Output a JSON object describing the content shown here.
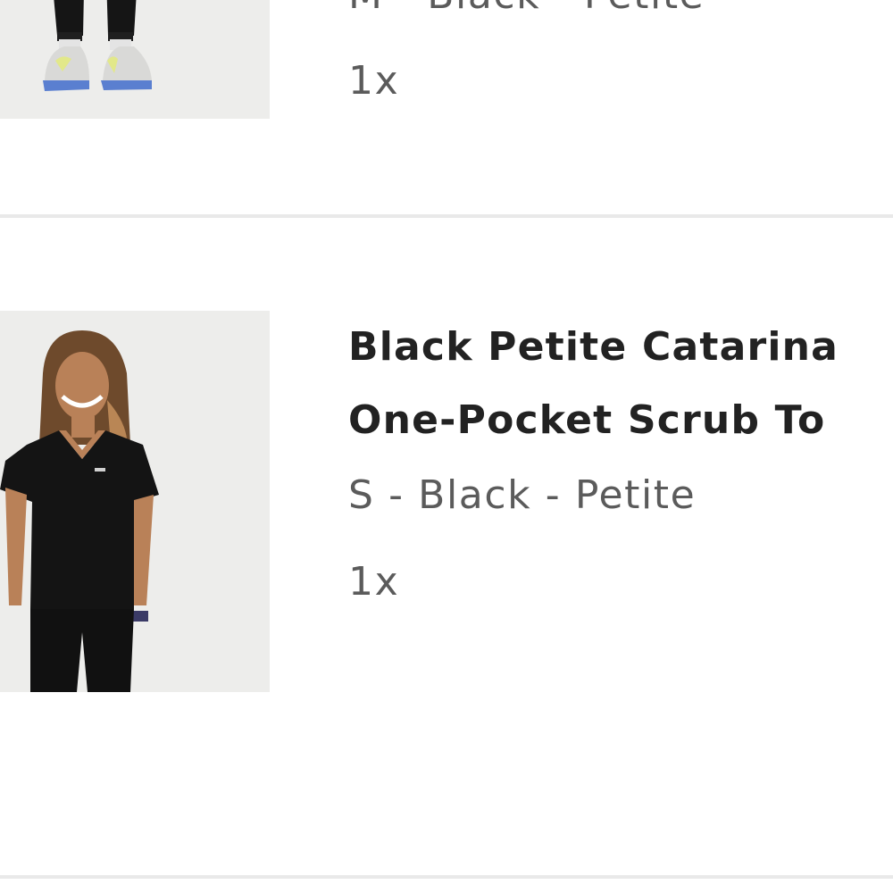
{
  "cart": {
    "items": [
      {
        "variant": "M - Black - Petite",
        "quantity": "1x",
        "image": "pants-and-sneakers-product-photo"
      },
      {
        "title_line1": "Black Petite Catarina",
        "title_line2": "One-Pocket Scrub To",
        "variant": "S - Black - Petite",
        "quantity": "1x",
        "image": "woman-in-black-scrub-top-product-photo"
      }
    ]
  }
}
